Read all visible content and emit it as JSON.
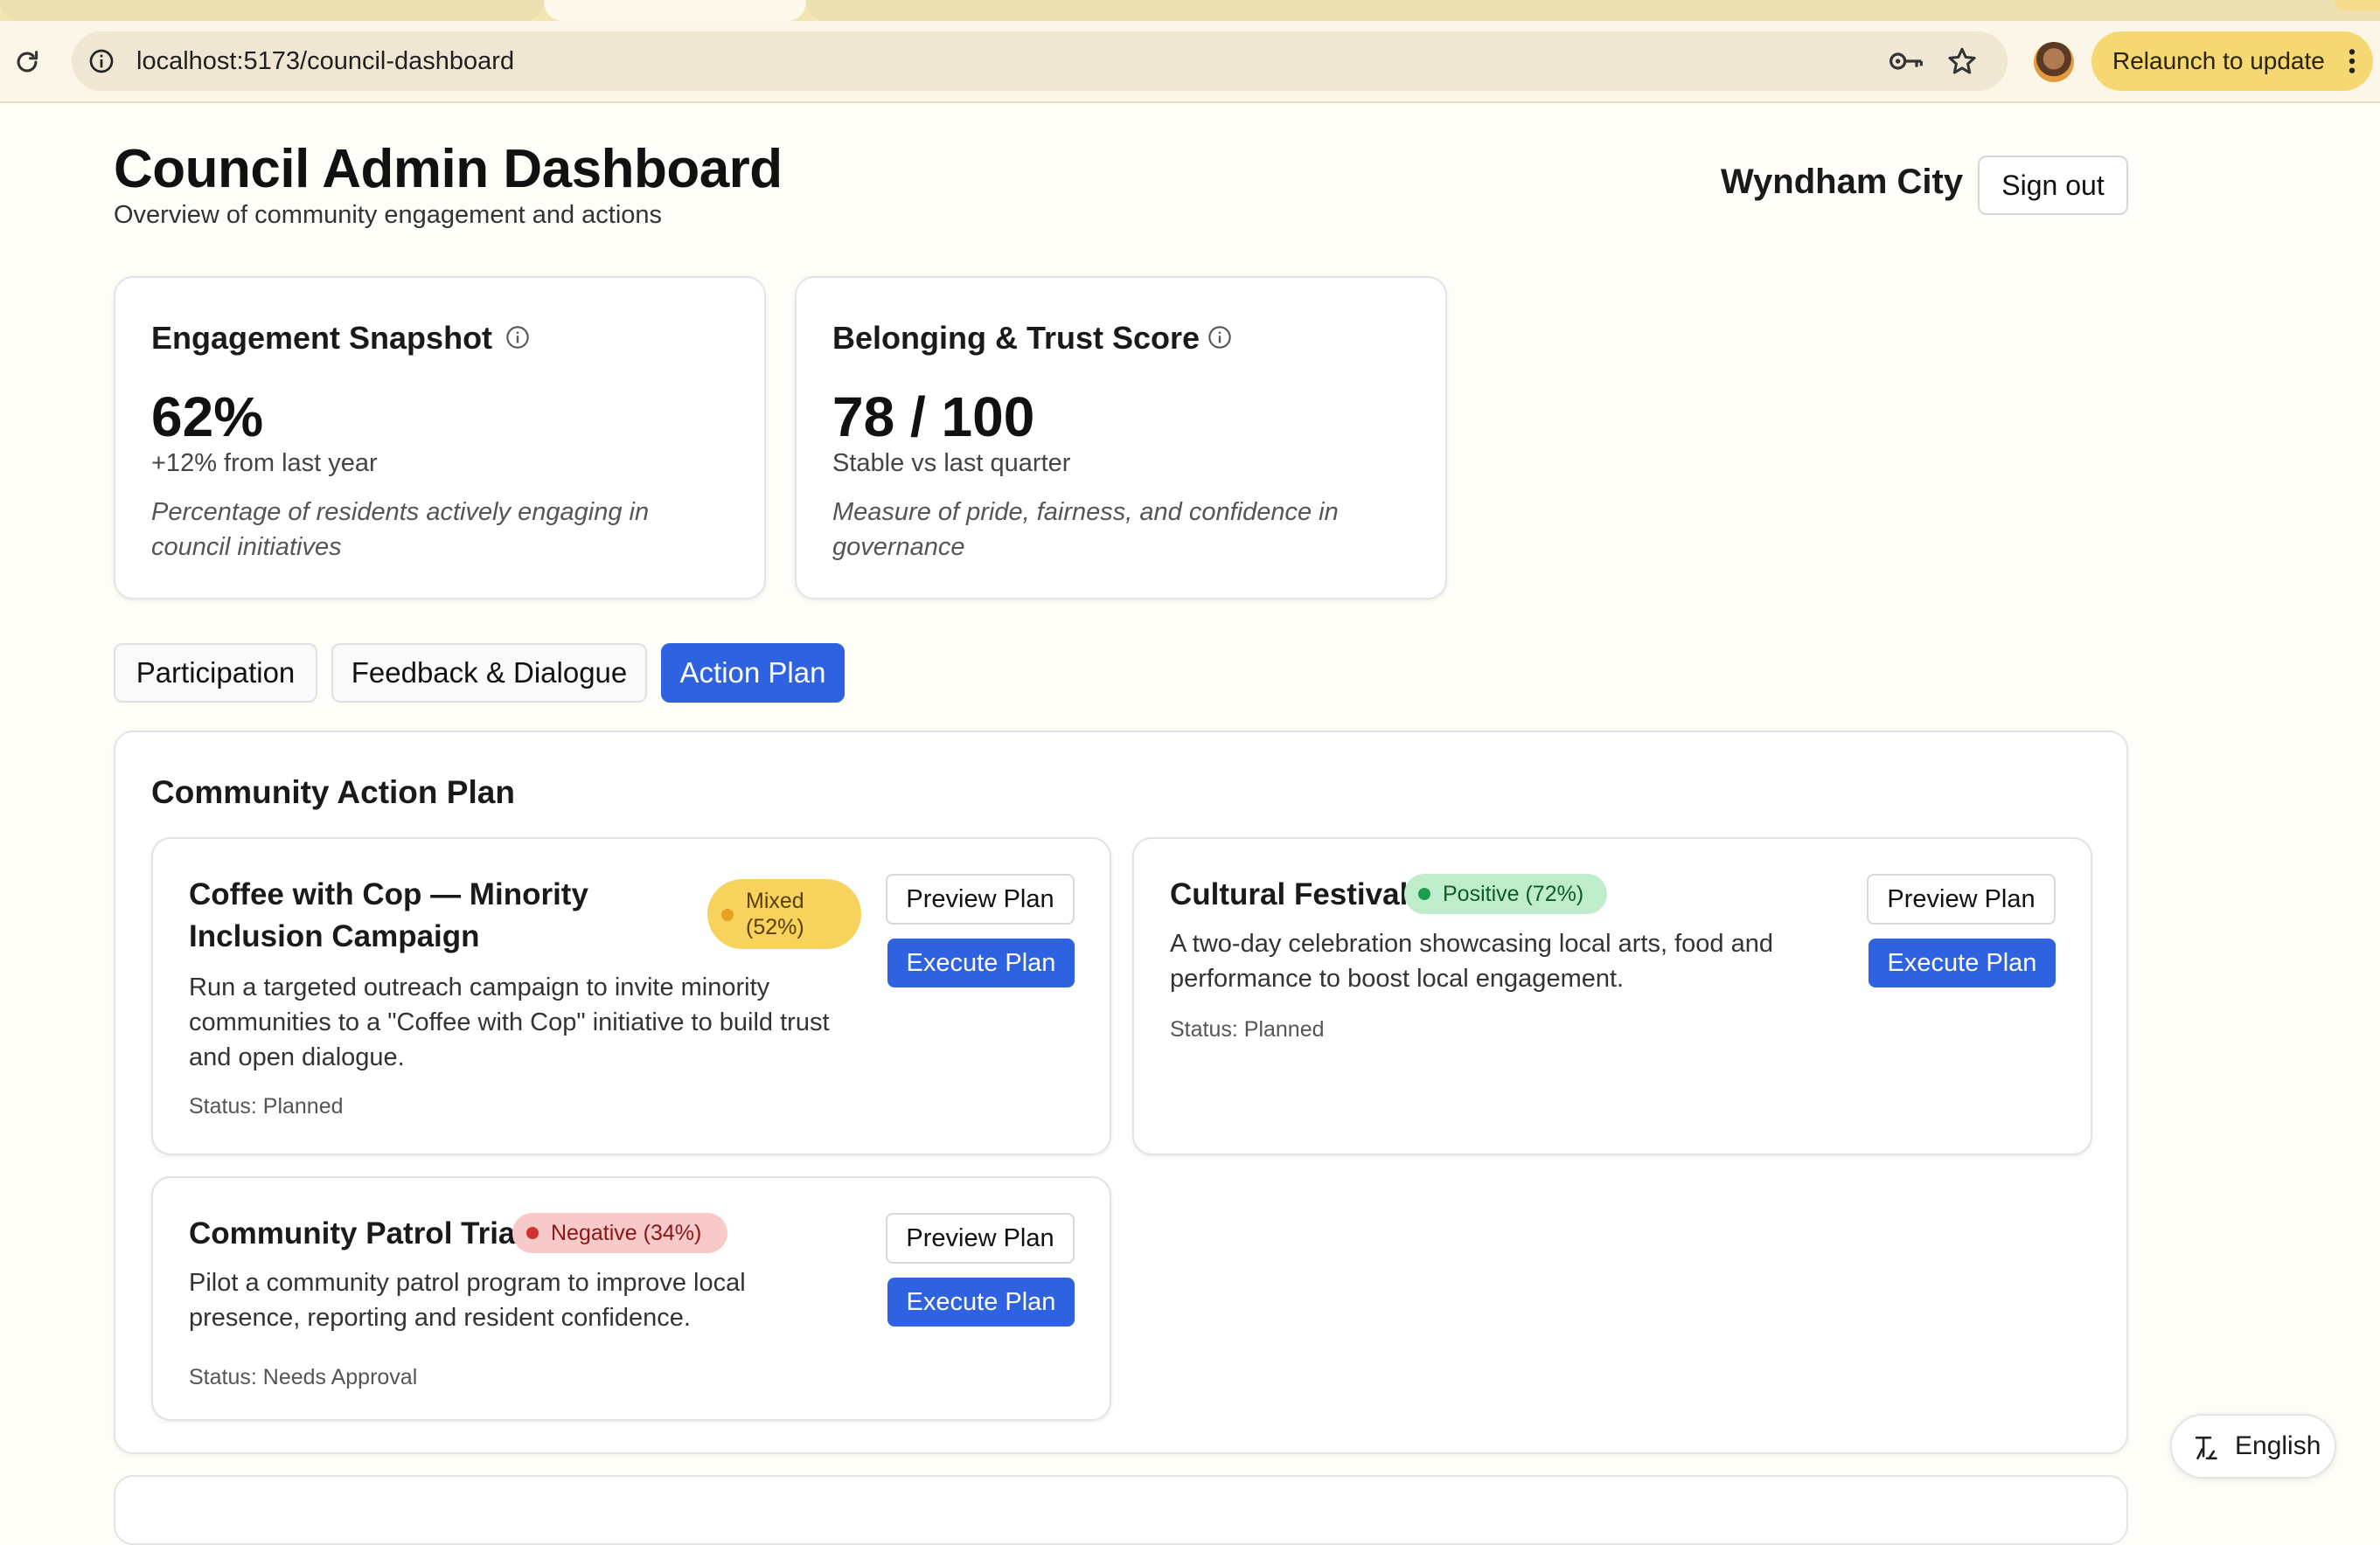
{
  "browser": {
    "url": "localhost:5173/council-dashboard",
    "relaunch_label": "Relaunch to update"
  },
  "header": {
    "title": "Council Admin Dashboard",
    "subtitle": "Overview of community engagement and actions",
    "org_name": "Wyndham City",
    "signout_label": "Sign out"
  },
  "stats": [
    {
      "title": "Engagement Snapshot",
      "value": "62%",
      "change": "+12% from last year",
      "description": "Percentage of residents actively engaging in council initiatives"
    },
    {
      "title": "Belonging & Trust Score",
      "value": "78 / 100",
      "change": "Stable vs last quarter",
      "description": "Measure of pride, fairness, and confidence in governance"
    }
  ],
  "tabs": [
    {
      "label": "Participation",
      "active": false
    },
    {
      "label": "Feedback & Dialogue",
      "active": false
    },
    {
      "label": "Action Plan",
      "active": true
    }
  ],
  "action_plan": {
    "title": "Community Action Plan",
    "preview_label": "Preview Plan",
    "execute_label": "Execute Plan",
    "plans": [
      {
        "title": "Coffee with Cop — Minority Inclusion Campaign",
        "sentiment": "Mixed",
        "sentiment_pct": "(52%)",
        "badge": "Mixed (52%)",
        "description": "Run a targeted outreach campaign to invite minority communities to a \"Coffee with Cop\" initiative to build trust and open dialogue.",
        "status": "Status: Planned",
        "color": "#f7d35e"
      },
      {
        "title": "Cultural Festival",
        "badge": "Positive (72%)",
        "description": "A two-day celebration showcasing local arts, food and performance to boost local engagement.",
        "status": "Status: Planned",
        "color": "#bfeccb"
      },
      {
        "title": "Community Patrol Trial",
        "badge": "Negative (34%)",
        "description": "Pilot a community patrol program to improve local presence, reporting and resident confidence.",
        "status": "Status: Needs Approval",
        "color": "#f8c9c9"
      }
    ]
  },
  "language": {
    "label": "English"
  },
  "colors": {
    "primary": "#2f62e0",
    "mixed": "#f7d35e",
    "positive": "#bfeccb",
    "negative": "#f8c9c9"
  },
  "icons": [
    "reload-icon",
    "site-info-icon",
    "key-icon",
    "star-icon",
    "more-vert-icon",
    "info-icon",
    "translate-icon"
  ]
}
